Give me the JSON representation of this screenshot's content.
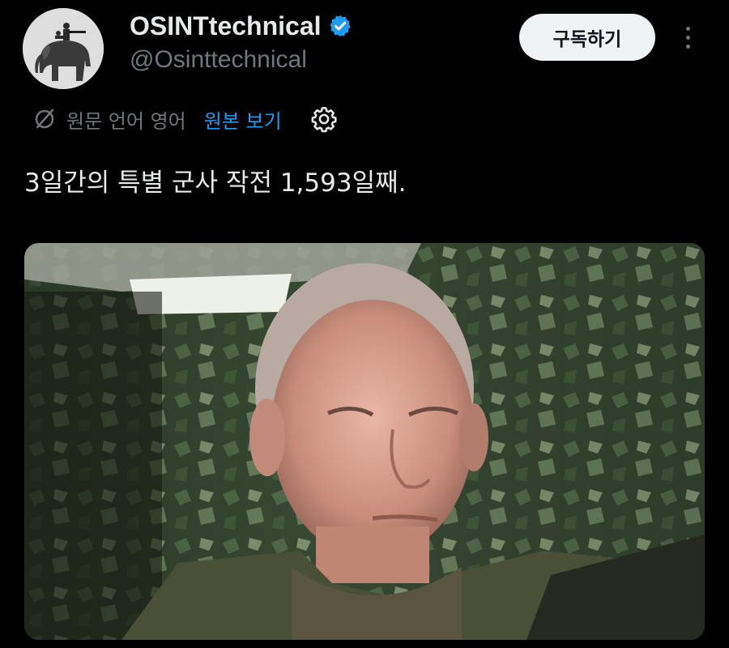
{
  "account": {
    "display_name": "OSINTtechnical",
    "handle": "@Osinttechnical",
    "verified": true,
    "avatar_icon": "soldier-on-elephant-avatar"
  },
  "actions": {
    "subscribe_label": "구독하기",
    "more_icon": "more-vertical-icon"
  },
  "translation": {
    "source_label": "원문 언어 영어",
    "show_original_label": "원본 보기",
    "icon": "translate-icon",
    "settings_icon": "gear-icon"
  },
  "tweet": {
    "text": "3일간의 특별 군사 작전 1,593일째."
  },
  "colors": {
    "background": "#000000",
    "text_primary": "#e7e9ea",
    "text_secondary": "#71767b",
    "link_blue": "#1d9bf0",
    "verified_blue": "#1d9bf0",
    "button_bg": "#eff3f4"
  }
}
